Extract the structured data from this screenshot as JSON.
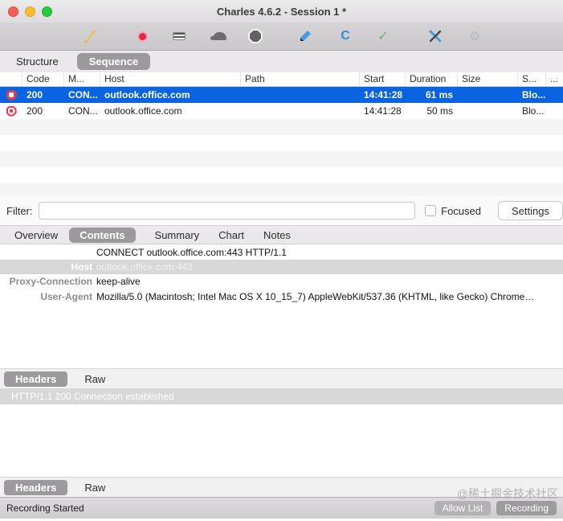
{
  "window": {
    "title": "Charles 4.6.2 - Session 1 *"
  },
  "toolbar": {
    "icons": [
      "clear-session",
      "record",
      "throttle",
      "throttling-turtle",
      "breakpoints",
      "compose",
      "repeat",
      "validate",
      "tools",
      "settings"
    ]
  },
  "view_tabs": {
    "structure": "Structure",
    "sequence": "Sequence"
  },
  "table": {
    "columns": [
      "Code",
      "M...",
      "Host",
      "Path",
      "Start",
      "Duration",
      "Size",
      "S...",
      "..."
    ],
    "rows": [
      {
        "code": "200",
        "method": "CON...",
        "host": "outlook.office.com",
        "path": "",
        "start": "14:41:28",
        "duration": "61 ms",
        "size": "",
        "status": "Blo...",
        "selected": true
      },
      {
        "code": "200",
        "method": "CON...",
        "host": "outlook.office.com",
        "path": "",
        "start": "14:41:28",
        "duration": "50 ms",
        "size": "",
        "status": "Blo...",
        "selected": false
      }
    ]
  },
  "filter": {
    "label": "Filter:",
    "value": "",
    "focused_label": "Focused",
    "settings_label": "Settings"
  },
  "detail_tabs": [
    "Overview",
    "Contents",
    "Summary",
    "Chart",
    "Notes"
  ],
  "detail_tabs_active": "Contents",
  "request": {
    "line": "CONNECT outlook.office.com:443 HTTP/1.1",
    "headers": [
      {
        "name": "Host",
        "value": "outlook.office.com:443"
      },
      {
        "name": "Proxy-Connection",
        "value": "keep-alive"
      },
      {
        "name": "User-Agent",
        "value": "Mozilla/5.0 (Macintosh; Intel Mac OS X 10_15_7) AppleWebKit/537.36 (KHTML, like Gecko) Chrome…"
      }
    ]
  },
  "pane_tabs": {
    "headers": "Headers",
    "raw": "Raw"
  },
  "response": {
    "status_line": "HTTP/1.1 200 Connection established"
  },
  "status_bar": {
    "text": "Recording Started",
    "allow_list_label": "Allow List",
    "recording_label": "Recording",
    "watermark": "@稀土掘金技术社区"
  },
  "colors": {
    "selection_blue": "#0a63e1",
    "pill_gray": "#9b999b",
    "record_red": "#e8234d",
    "lock_octagon_red": "#e23c50",
    "selected_header_gray": "#d8d7d8"
  }
}
